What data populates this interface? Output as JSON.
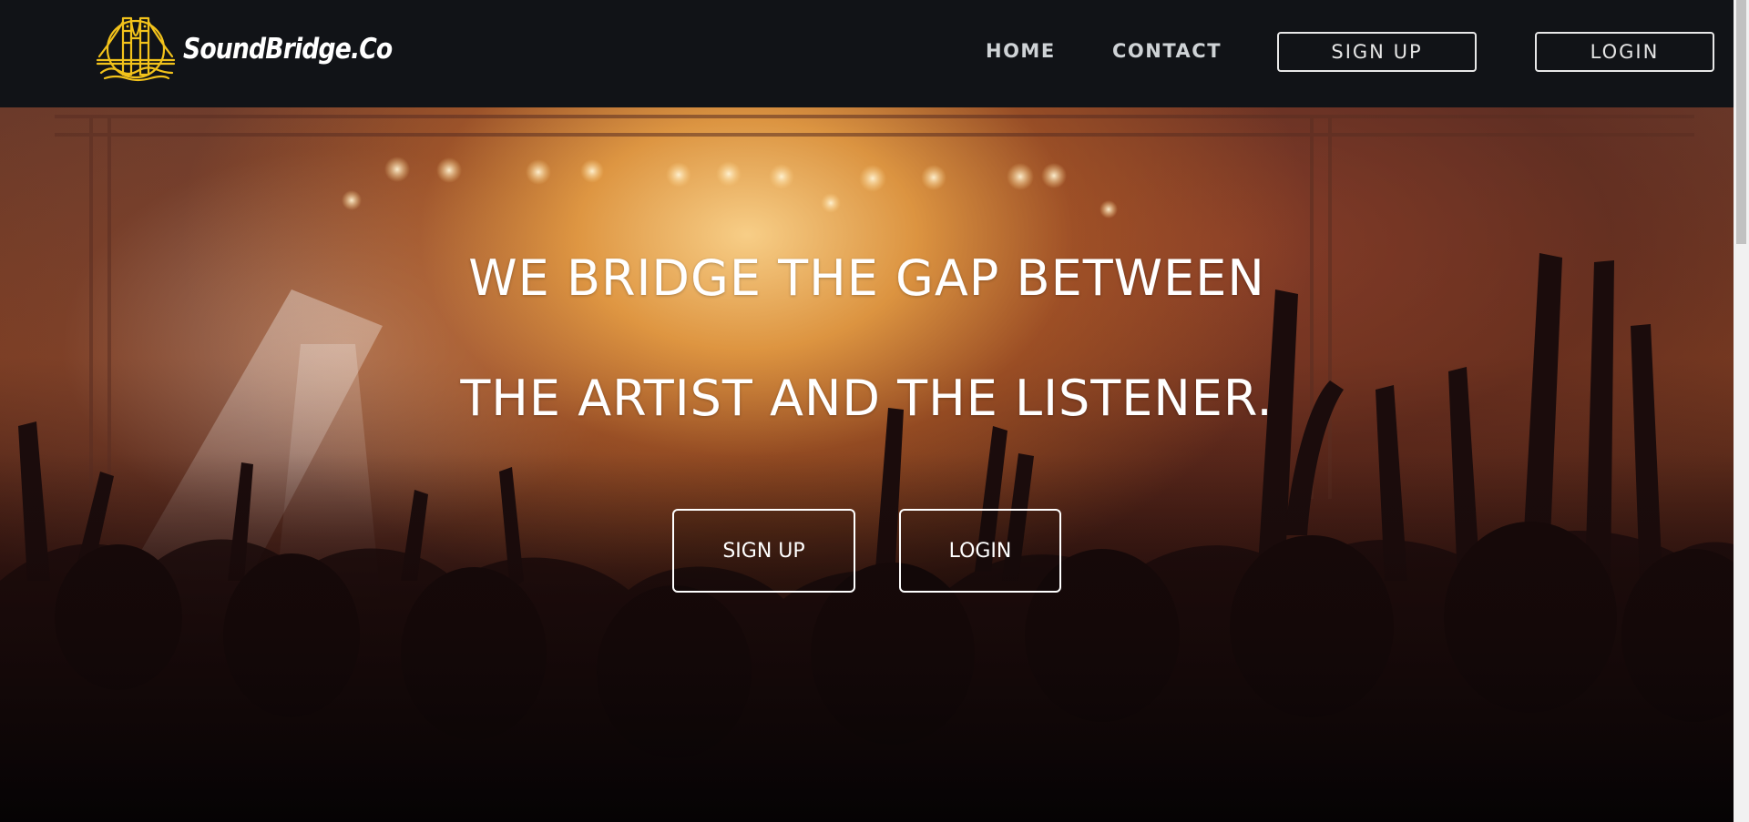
{
  "brand": {
    "name": "SoundBridge.Co",
    "logo_icon": "golden-gate-bridge-icon",
    "logo_color": "#f2c21b"
  },
  "nav": {
    "home_label": "HOME",
    "contact_label": "CONTACT",
    "signup_label": "SIGN UP",
    "login_label": "LOGIN"
  },
  "hero": {
    "background": "concert-crowd-stage-lights",
    "headline_line1": "WE BRIDGE THE GAP BETWEEN",
    "headline_line2": "THE ARTIST AND THE LISTENER.",
    "signup_label": "SIGN UP",
    "login_label": "LOGIN"
  },
  "colors": {
    "navbar_bg": "#111317",
    "nav_text": "#cfd3d6",
    "hero_text": "#ffffff"
  }
}
